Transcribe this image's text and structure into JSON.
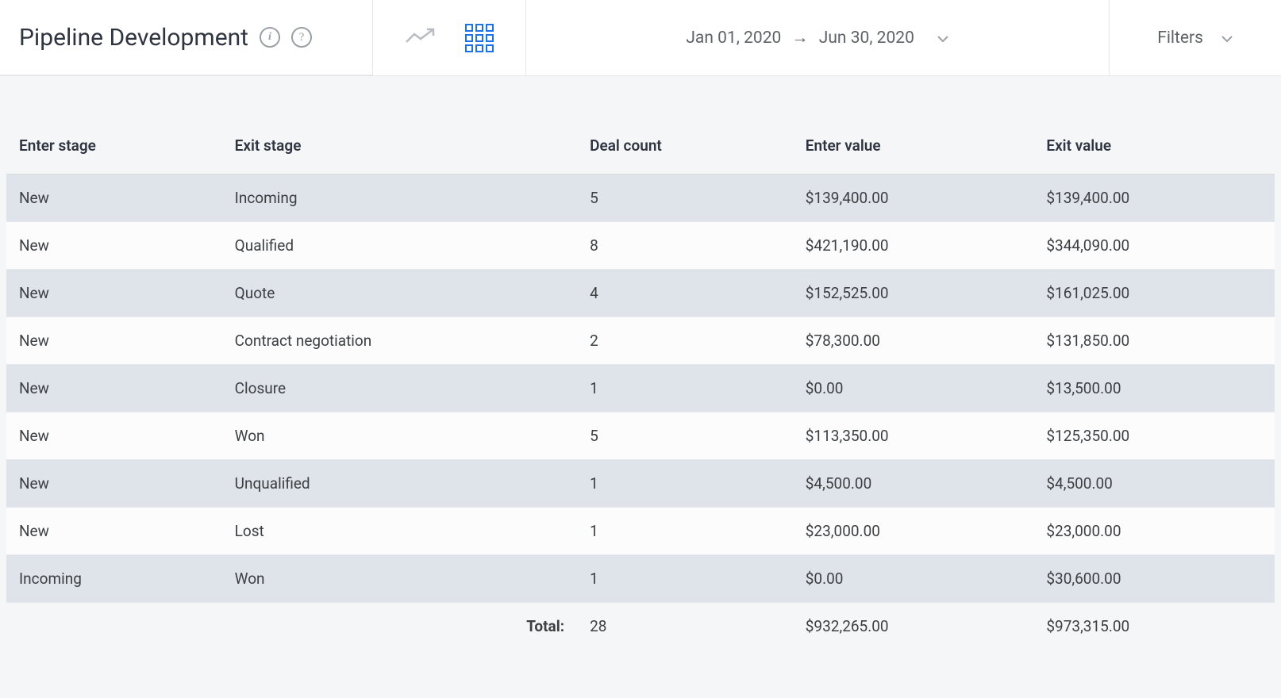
{
  "header": {
    "title": "Pipeline Development",
    "date_from": "Jan 01, 2020",
    "date_to": "Jun 30, 2020",
    "filters_label": "Filters"
  },
  "table": {
    "columns": {
      "enter_stage": "Enter stage",
      "exit_stage": "Exit stage",
      "deal_count": "Deal count",
      "enter_value": "Enter value",
      "exit_value": "Exit value"
    },
    "rows": [
      {
        "enter_stage": "New",
        "exit_stage": "Incoming",
        "deal_count": "5",
        "enter_value": "$139,400.00",
        "exit_value": "$139,400.00"
      },
      {
        "enter_stage": "New",
        "exit_stage": "Qualified",
        "deal_count": "8",
        "enter_value": "$421,190.00",
        "exit_value": "$344,090.00"
      },
      {
        "enter_stage": "New",
        "exit_stage": "Quote",
        "deal_count": "4",
        "enter_value": "$152,525.00",
        "exit_value": "$161,025.00"
      },
      {
        "enter_stage": "New",
        "exit_stage": "Contract negotiation",
        "deal_count": "2",
        "enter_value": "$78,300.00",
        "exit_value": "$131,850.00"
      },
      {
        "enter_stage": "New",
        "exit_stage": "Closure",
        "deal_count": "1",
        "enter_value": "$0.00",
        "exit_value": "$13,500.00"
      },
      {
        "enter_stage": "New",
        "exit_stage": "Won",
        "deal_count": "5",
        "enter_value": "$113,350.00",
        "exit_value": "$125,350.00"
      },
      {
        "enter_stage": "New",
        "exit_stage": "Unqualified",
        "deal_count": "1",
        "enter_value": "$4,500.00",
        "exit_value": "$4,500.00"
      },
      {
        "enter_stage": "New",
        "exit_stage": "Lost",
        "deal_count": "1",
        "enter_value": "$23,000.00",
        "exit_value": "$23,000.00"
      },
      {
        "enter_stage": "Incoming",
        "exit_stage": "Won",
        "deal_count": "1",
        "enter_value": "$0.00",
        "exit_value": "$30,600.00"
      }
    ],
    "total": {
      "label": "Total:",
      "deal_count": "28",
      "enter_value": "$932,265.00",
      "exit_value": "$973,315.00"
    }
  }
}
